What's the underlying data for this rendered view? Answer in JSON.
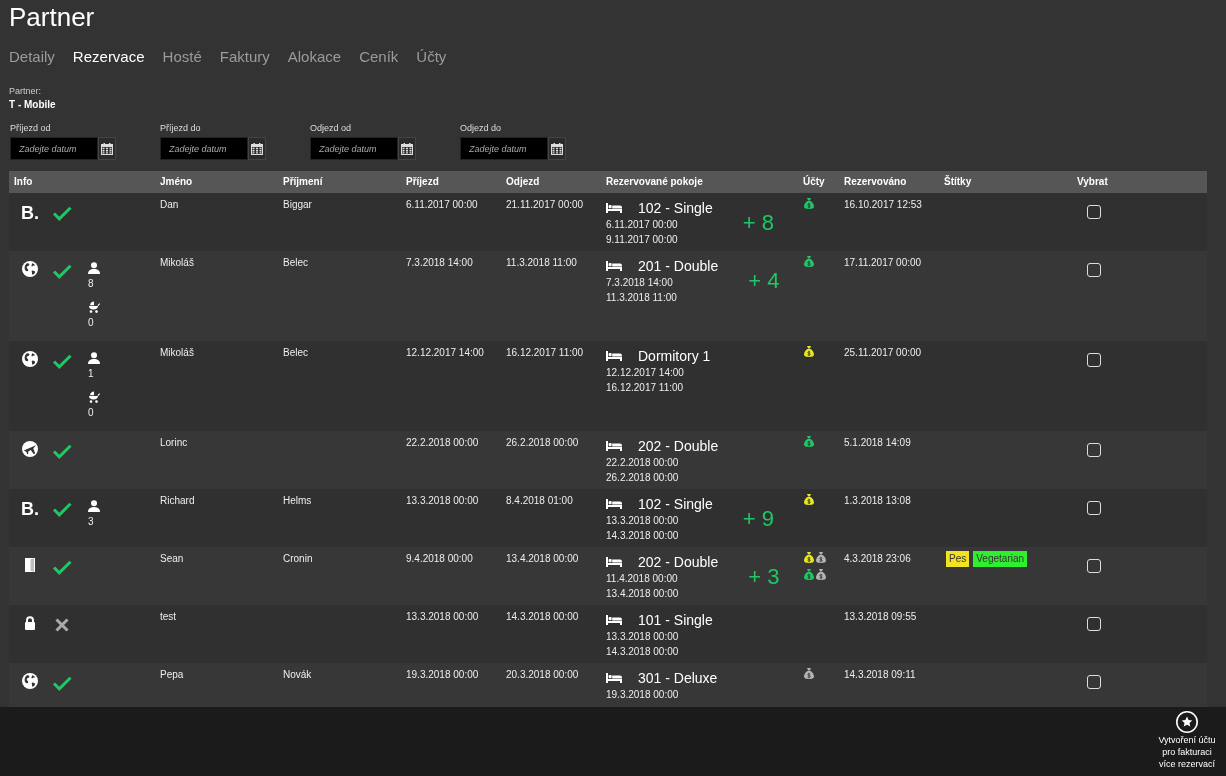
{
  "page": {
    "title": "Partner"
  },
  "tabs": [
    {
      "label": "Detaily",
      "selected": false
    },
    {
      "label": "Rezervace",
      "selected": true
    },
    {
      "label": "Hosté",
      "selected": false
    },
    {
      "label": "Faktury",
      "selected": false
    },
    {
      "label": "Alokace",
      "selected": false
    },
    {
      "label": "Ceník",
      "selected": false
    },
    {
      "label": "Účty",
      "selected": false
    }
  ],
  "partner": {
    "label": "Partner:",
    "value": "T - Mobile"
  },
  "filters": [
    {
      "label": "Příjezd od",
      "placeholder": "Zadejte datum"
    },
    {
      "label": "Příjezd do",
      "placeholder": "Zadejte datum"
    },
    {
      "label": "Odjezd od",
      "placeholder": "Zadejte datum"
    },
    {
      "label": "Odjezd do",
      "placeholder": "Zadejte datum"
    }
  ],
  "table": {
    "columns": [
      "Info",
      "Jméno",
      "Příjmení",
      "Příjezd",
      "Odjezd",
      "Rezervované pokoje",
      "Účty",
      "Rezervováno",
      "Štítky",
      "Vybrat"
    ],
    "rows": [
      {
        "source": {
          "kind": "letter",
          "text": "B."
        },
        "confirmed": true,
        "first_name": "Dan",
        "last_name": "Biggar",
        "arrival": "6.11.2017 00:00",
        "departure": "21.11.2017 00:00",
        "room": {
          "name": "102 - Single",
          "from": "6.11.2017 00:00",
          "to": "9.11.2017 00:00"
        },
        "more_rooms": "+ 8",
        "accounts": [
          {
            "color": "#1ec864"
          }
        ],
        "booked": "16.10.2017 12:53",
        "checked": false
      },
      {
        "source": {
          "kind": "globe"
        },
        "confirmed": true,
        "guests": [
          {
            "kind": "adults",
            "count": "8"
          },
          {
            "kind": "children",
            "count": "0"
          }
        ],
        "first_name": "Mikoláš",
        "last_name": "Belec",
        "arrival": "7.3.2018 14:00",
        "departure": "11.3.2018 11:00",
        "room": {
          "name": "201 - Double",
          "from": "7.3.2018 14:00",
          "to": "11.3.2018 11:00"
        },
        "more_rooms": "+ 4",
        "accounts": [
          {
            "color": "#1ec864"
          }
        ],
        "booked": "17.11.2017 00:00",
        "checked": false
      },
      {
        "source": {
          "kind": "globe"
        },
        "confirmed": true,
        "guests": [
          {
            "kind": "adults",
            "count": "1"
          },
          {
            "kind": "children",
            "count": "0"
          }
        ],
        "first_name": "Mikoláš",
        "last_name": "Belec",
        "arrival": "12.12.2017 14:00",
        "departure": "16.12.2017 11:00",
        "room": {
          "name": "Dormitory 1",
          "from": "12.12.2017 14:00",
          "to": "16.12.2017 11:00"
        },
        "accounts": [
          {
            "color": "#e8e81a"
          }
        ],
        "booked": "25.11.2017 00:00",
        "checked": false
      },
      {
        "source": {
          "kind": "plane"
        },
        "confirmed": true,
        "first_name": "Lorinc",
        "arrival": "22.2.2018 00:00",
        "departure": "26.2.2018 00:00",
        "room": {
          "name": "202 - Double",
          "from": "22.2.2018 00:00",
          "to": "26.2.2018 00:00"
        },
        "accounts": [
          {
            "color": "#1ec864"
          }
        ],
        "booked": "5.1.2018 14:09",
        "checked": false
      },
      {
        "source": {
          "kind": "letter",
          "text": "B."
        },
        "confirmed": true,
        "guests": [
          {
            "kind": "adults",
            "count": "3"
          }
        ],
        "first_name": "Richard",
        "last_name": "Helms",
        "arrival": "13.3.2018 00:00",
        "departure": "8.4.2018 01:00",
        "room": {
          "name": "102 - Single",
          "from": "13.3.2018 00:00",
          "to": "14.3.2018 00:00"
        },
        "more_rooms": "+ 9",
        "accounts": [
          {
            "color": "#e8e81a"
          }
        ],
        "booked": "1.3.2018 13:08",
        "checked": false
      },
      {
        "source": {
          "kind": "door"
        },
        "confirmed": true,
        "first_name": "Sean",
        "last_name": "Cronin",
        "arrival": "9.4.2018 00:00",
        "departure": "13.4.2018 00:00",
        "room": {
          "name": "202 - Double",
          "from": "11.4.2018 00:00",
          "to": "13.4.2018 00:00"
        },
        "more_rooms": "+ 3",
        "accounts": [
          {
            "color": "#e8e81a"
          },
          {
            "color": "#b4b4b4"
          },
          {
            "color": "#1ec864"
          },
          {
            "color": "#b4b4b4"
          }
        ],
        "booked": "4.3.2018 23:06",
        "tags": [
          {
            "label": "Pes",
            "color": "#f2e21f"
          },
          {
            "label": "Vegetarian",
            "color": "#2ff02f"
          }
        ],
        "checked": false
      },
      {
        "source": {
          "kind": "lock"
        },
        "confirmed": false,
        "first_name": "test",
        "arrival": "13.3.2018 00:00",
        "departure": "14.3.2018 00:00",
        "room": {
          "name": "101 - Single",
          "from": "13.3.2018 00:00",
          "to": "14.3.2018 00:00"
        },
        "booked": "13.3.2018 09:55",
        "checked": false
      },
      {
        "source": {
          "kind": "globe"
        },
        "confirmed": true,
        "first_name": "Pepa",
        "last_name": "Novák",
        "arrival": "19.3.2018 00:00",
        "departure": "20.3.2018 00:00",
        "room": {
          "name": "301 - Deluxe",
          "from": "19.3.2018 00:00"
        },
        "accounts": [
          {
            "color": "#b4b4b4"
          }
        ],
        "booked": "14.3.2018 09:11",
        "checked": false
      }
    ]
  },
  "footer": {
    "action": "Vytvoření účtu pro fakturaci více rezervací"
  }
}
